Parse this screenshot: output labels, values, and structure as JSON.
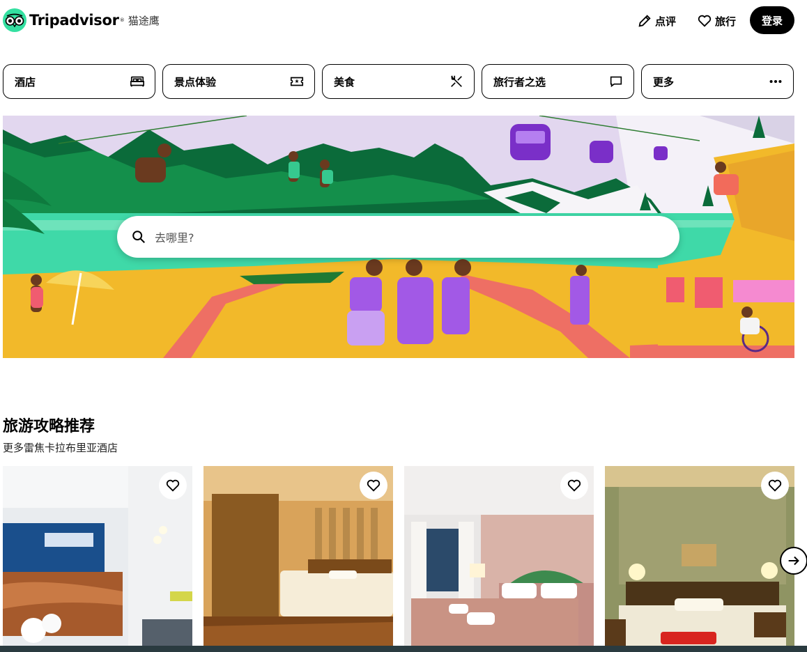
{
  "header": {
    "brand": "Tripadvisor",
    "brand_cn": "猫途鹰",
    "review_label": "点评",
    "trips_label": "旅行",
    "login_label": "登录"
  },
  "categories": [
    {
      "label": "酒店",
      "icon": "bed-icon"
    },
    {
      "label": "景点体验",
      "icon": "ticket-icon"
    },
    {
      "label": "美食",
      "icon": "cutlery-icon"
    },
    {
      "label": "旅行者之选",
      "icon": "speech-bubble-icon"
    },
    {
      "label": "更多",
      "icon": "more-dots-icon"
    }
  ],
  "search": {
    "placeholder": "去哪里?"
  },
  "recommendations": {
    "title": "旅游攻略推荐",
    "subtitle": "更多雷焦卡拉布里亚酒店",
    "cards": [
      {
        "photo": "hotel lobby reception"
      },
      {
        "photo": "hotel room with striped wall"
      },
      {
        "photo": "hotel room with pink wall"
      },
      {
        "photo": "hotel room with green wall"
      }
    ]
  },
  "colors": {
    "brand_green": "#34e0a1",
    "black": "#000000",
    "sky": "#e2d7ef",
    "mountain": "#0b6b3a",
    "beach": "#f2b92a",
    "sea": "#3fd9a8"
  }
}
